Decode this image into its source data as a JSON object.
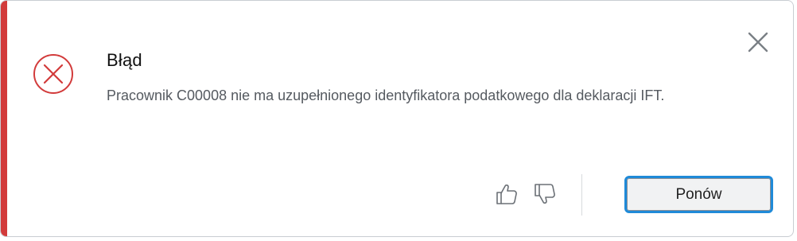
{
  "dialog": {
    "title": "Błąd",
    "message": "Pracownik C00008 nie ma uzupełnionego identyfikatora podatkowego dla deklaracji IFT.",
    "severity_icon": "error-circle-x-icon",
    "accent_color": "#d23b3b",
    "close_icon": "close-icon",
    "feedback": {
      "thumbs_up_icon": "thumbs-up-icon",
      "thumbs_down_icon": "thumbs-down-icon"
    },
    "retry_label": "Ponów",
    "focus_color": "#1f8ad8"
  }
}
